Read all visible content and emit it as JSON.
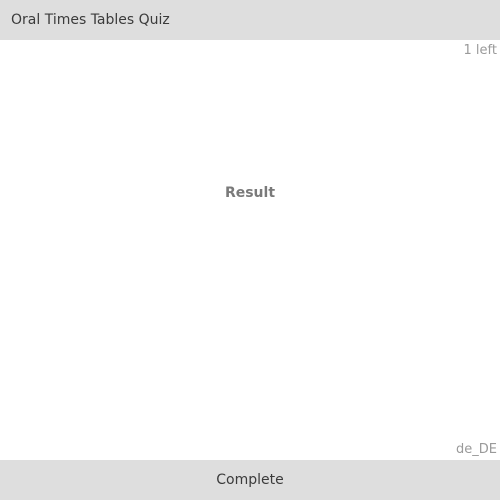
{
  "header": {
    "title": "Oral Times Tables Quiz"
  },
  "main": {
    "remaining": "1 left",
    "result_label": "Result",
    "locale": "de_DE"
  },
  "footer": {
    "complete_label": "Complete"
  }
}
